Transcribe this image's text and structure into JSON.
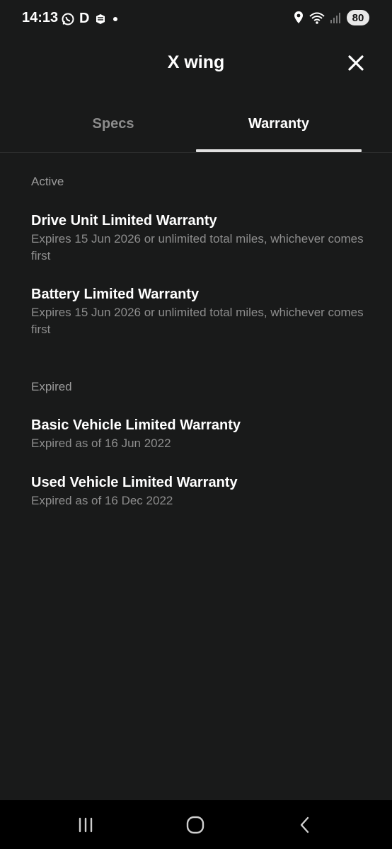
{
  "status_bar": {
    "time": "14:13",
    "left_icons": [
      "whatsapp-icon",
      "d-app-icon",
      "app-box-icon",
      "dot-icon"
    ],
    "d_letter": "D",
    "right_icons": [
      "location-icon",
      "wifi-icon",
      "signal-icon"
    ],
    "battery": "80"
  },
  "header": {
    "title": "X wing",
    "close_icon": "close-icon"
  },
  "tabs": [
    {
      "label": "Specs",
      "active": false
    },
    {
      "label": "Warranty",
      "active": true
    }
  ],
  "sections": {
    "active": {
      "label": "Active",
      "items": [
        {
          "title": "Drive Unit Limited Warranty",
          "subtitle": "Expires 15 Jun 2026 or unlimited total miles, whichever comes first"
        },
        {
          "title": "Battery Limited Warranty",
          "subtitle": "Expires 15 Jun 2026 or unlimited total miles, whichever comes first"
        }
      ]
    },
    "expired": {
      "label": "Expired",
      "items": [
        {
          "title": "Basic Vehicle Limited Warranty",
          "subtitle": "Expired as of 16 Jun 2022"
        },
        {
          "title": "Used Vehicle Limited Warranty",
          "subtitle": "Expired as of 16 Dec 2022"
        }
      ]
    }
  },
  "nav_bar": {
    "icons": [
      "recent-apps-icon",
      "home-icon",
      "back-icon"
    ]
  },
  "colors": {
    "background": "#191a1a",
    "text_primary": "#ffffff",
    "text_secondary": "#8d8d8d",
    "tab_indicator": "#e0e0e0"
  }
}
